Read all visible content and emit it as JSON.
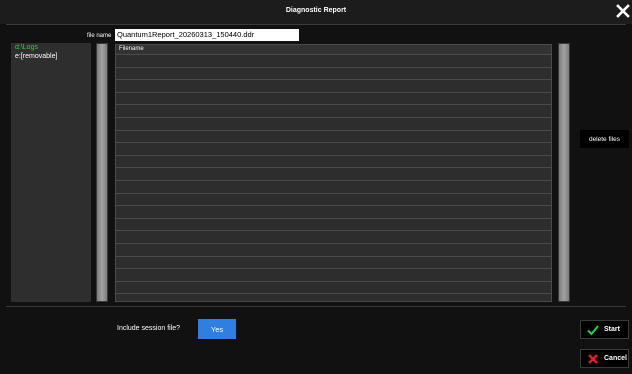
{
  "window": {
    "title": "Diagnostic Report",
    "close_icon": "close-icon"
  },
  "file_name": {
    "label": "file name",
    "value": "Quantum1Report_20260313_150440.ddr"
  },
  "drives": {
    "items": [
      {
        "label": "d:\\Logs",
        "selected": true
      },
      {
        "label": "e:[removable]",
        "selected": false
      }
    ],
    "selected_color": "#22d33a"
  },
  "file_list": {
    "column_header": "Filename",
    "rows": []
  },
  "buttons": {
    "delete_files": "delete files",
    "start": "Start",
    "cancel": "Cancel",
    "start_icon": "check-icon",
    "cancel_icon": "cross-icon"
  },
  "session": {
    "label": "Include session file?",
    "value": "Yes",
    "accent": "#2f7fe0"
  }
}
